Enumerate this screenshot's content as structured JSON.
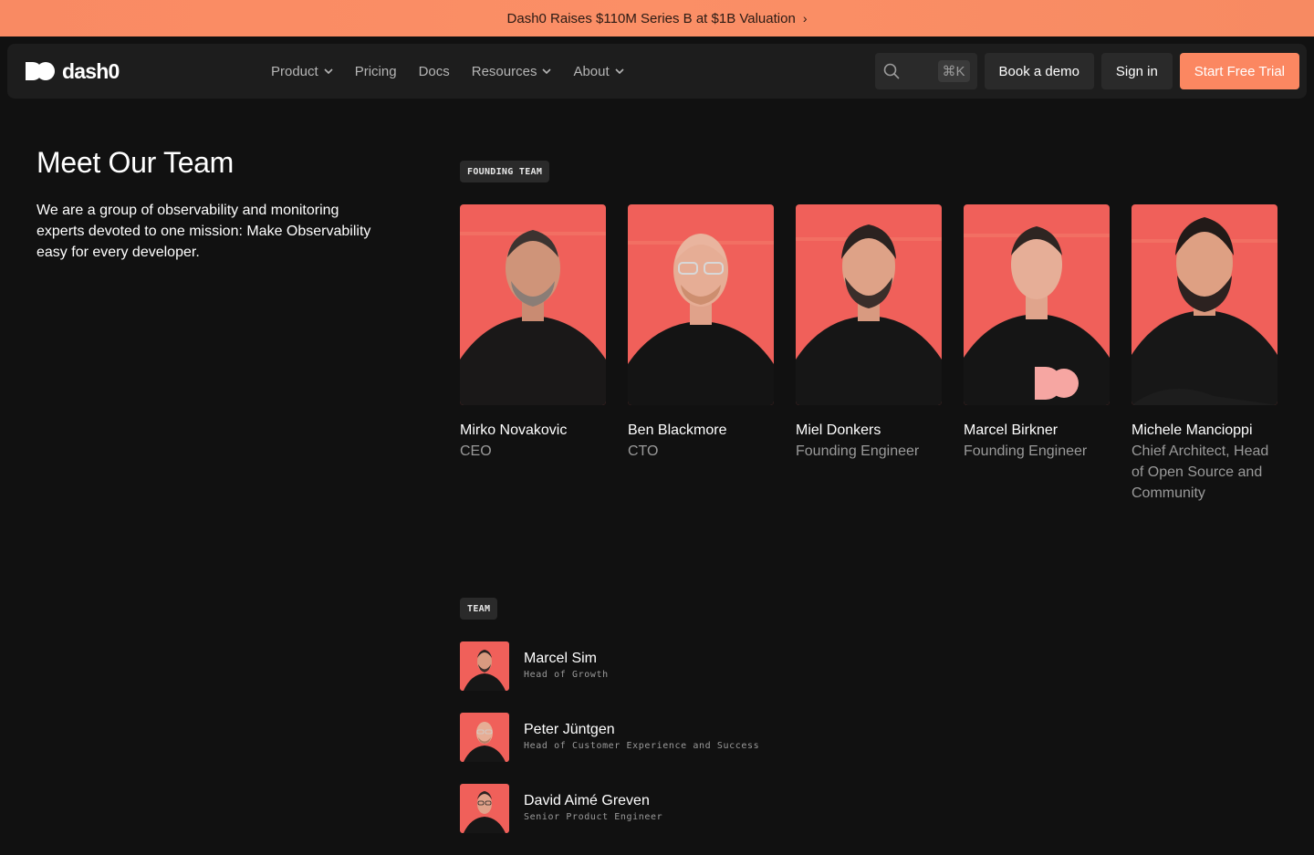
{
  "banner": {
    "text": "Dash0 Raises $110M Series B at $1B Valuation",
    "chevron": "›"
  },
  "nav": {
    "logo_text": "dash0",
    "links": [
      {
        "label": "Product",
        "dropdown": true
      },
      {
        "label": "Pricing",
        "dropdown": false
      },
      {
        "label": "Docs",
        "dropdown": false
      },
      {
        "label": "Resources",
        "dropdown": true
      },
      {
        "label": "About",
        "dropdown": true
      }
    ],
    "search_shortcut": "⌘K",
    "book_demo": "Book a demo",
    "sign_in": "Sign in",
    "start_trial": "Start Free Trial"
  },
  "intro": {
    "title": "Meet Our Team",
    "text": "We are a group of observability and monitoring experts devoted to one mission: Make Observability easy for every developer."
  },
  "founding": {
    "tag": "FOUNDING TEAM",
    "members": [
      {
        "name": "Mirko Novakovic",
        "role": "CEO"
      },
      {
        "name": "Ben Blackmore",
        "role": "CTO"
      },
      {
        "name": "Miel Donkers",
        "role": "Founding Engineer"
      },
      {
        "name": "Marcel Birkner",
        "role": "Founding Engineer"
      },
      {
        "name": "Michele Mancioppi",
        "role": "Chief Architect, Head of Open Source and Community"
      }
    ]
  },
  "team": {
    "tag": "TEAM",
    "members": [
      {
        "name": "Marcel Sim",
        "role": "Head of Growth"
      },
      {
        "name": "Peter Jüntgen",
        "role": "Head of Customer Experience and Success"
      },
      {
        "name": "David Aimé Greven",
        "role": "Senior Product Engineer"
      }
    ]
  },
  "colors": {
    "accent": "#fb8761",
    "photo_bg": "#f0605a",
    "background": "#111111",
    "nav_bg": "#1d1d1d"
  }
}
